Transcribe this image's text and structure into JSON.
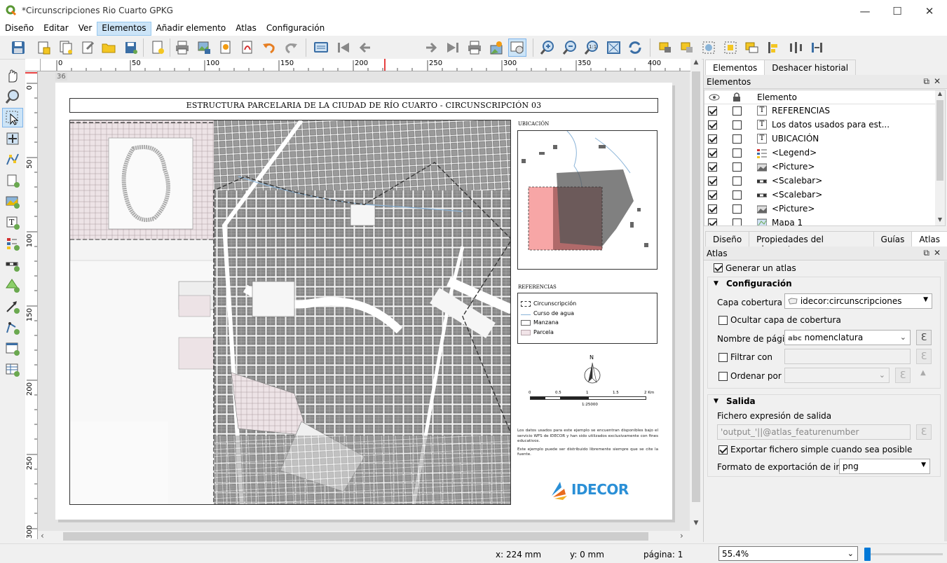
{
  "window": {
    "title": "*Circunscripciones Rio Cuarto GPKG",
    "controls": [
      "—",
      "☐",
      "✕"
    ]
  },
  "menu": [
    "Diseño",
    "Editar",
    "Ver",
    "Elementos",
    "Añadir elemento",
    "Atlas",
    "Configuración"
  ],
  "menu_active": "Elementos",
  "toolbar": {
    "page_number": "1",
    "icons": [
      "save-icon",
      "new-layout-icon",
      "duplicate-layout-icon",
      "layout-manager-icon",
      "open-template-icon",
      "save-template-icon",
      "new-page-icon",
      "print-icon",
      "export-image-icon",
      "export-svg-icon",
      "export-pdf-icon",
      "undo-icon",
      "redo-icon",
      "atlas-preview-icon",
      "first-feature-icon",
      "previous-feature-icon",
      "next-feature-icon",
      "last-feature-icon",
      "atlas-print-icon",
      "atlas-export-icon",
      "atlas-settings-icon",
      "zoom-in-icon",
      "zoom-out-icon",
      "zoom-actual-icon",
      "zoom-full-icon",
      "refresh-icon",
      "lock-icon",
      "unlock-icon",
      "group-icon",
      "ungroup-icon",
      "raise-icon",
      "align-icon",
      "distribute-icon",
      "resize-icon"
    ]
  },
  "left_tools": [
    "pan-icon",
    "zoom-tool-icon",
    "select-icon",
    "move-content-icon",
    "edit-nodes-icon",
    "add-map-icon",
    "add-picture-icon",
    "add-label-icon",
    "add-legend-icon",
    "add-scalebar-icon",
    "add-shape-icon",
    "add-arrow-icon",
    "add-node-item-icon",
    "add-html-icon",
    "add-table-icon"
  ],
  "rulers": {
    "h_labels": [
      "0",
      "50",
      "100",
      "150",
      "200",
      "250",
      "300",
      "350",
      "400"
    ],
    "v_labels": [
      "0",
      "50",
      "100",
      "150",
      "200",
      "250",
      "300"
    ],
    "marker": "36"
  },
  "layout": {
    "title": "ESTRUCTURA PARCELARIA DE LA CIUDAD DE RÍO CUARTO - CIRCUNSCRIPCIÓN 03",
    "ubicacion_label": "UBICACIÓN",
    "referencias_label": "REFERENCIAS",
    "legend": [
      "Circunscripción",
      "Curso de agua",
      "Manzana",
      "Parcela"
    ],
    "north": "N",
    "scale_ticks": [
      "0",
      "0.5",
      "1",
      "1.5",
      "2 Km"
    ],
    "scale_ratio": "1:25000",
    "disclaimer1": "Los datos usados para este ejemplo se encuentran disponibles bajo el servicio WFS de IDECOR y han sido utilizados exclusivamente con fines educativos.",
    "disclaimer2": "Este ejemplo puede ser distribuido libremente siempre que se cite la fuente.",
    "logo_text": "IDECOR",
    "colors": {
      "parcel": "#ddd0d4",
      "circ_highlight": "#f4a5a5",
      "logo": "#2a8fd6"
    }
  },
  "right_panel": {
    "top_tabs": [
      "Elementos",
      "Deshacer historial"
    ],
    "items_title": "Elementos",
    "items_header": "Elemento",
    "items": [
      {
        "visible": true,
        "locked": false,
        "icon": "label-item-icon",
        "name": "REFERENCIAS"
      },
      {
        "visible": true,
        "locked": false,
        "icon": "label-item-icon",
        "name": "Los datos usados para est..."
      },
      {
        "visible": true,
        "locked": false,
        "icon": "label-item-icon",
        "name": "UBICACIÓN"
      },
      {
        "visible": true,
        "locked": false,
        "icon": "legend-item-icon",
        "name": "<Legend>"
      },
      {
        "visible": true,
        "locked": false,
        "icon": "picture-item-icon",
        "name": "<Picture>"
      },
      {
        "visible": true,
        "locked": false,
        "icon": "scalebar-item-icon",
        "name": "<Scalebar>"
      },
      {
        "visible": true,
        "locked": false,
        "icon": "scalebar-item-icon",
        "name": "<Scalebar>"
      },
      {
        "visible": true,
        "locked": false,
        "icon": "picture-item-icon",
        "name": "<Picture>"
      },
      {
        "visible": true,
        "locked": false,
        "icon": "map-item-icon",
        "name": "Mapa 1"
      }
    ],
    "bottom_tabs": [
      "Diseño",
      "Propiedades del elemento",
      "Guías",
      "Atlas"
    ],
    "bottom_tab_selected": "Atlas",
    "atlas_title": "Atlas",
    "generate_atlas": {
      "label": "Generar un atlas",
      "checked": true
    },
    "config_label": "Configuración",
    "coverage_label": "Capa cobertura",
    "coverage_value": "idecor:circunscripciones",
    "hide_coverage": {
      "label": "Ocultar capa de cobertura",
      "checked": false
    },
    "page_name_label": "Nombre de página",
    "page_name_prefix": "abc",
    "page_name_value": "nomenclatura",
    "filter": {
      "label": "Filtrar con",
      "checked": false
    },
    "sort": {
      "label": "Ordenar por",
      "checked": false
    },
    "output_label": "Salida",
    "output_expr_label": "Fichero expresión de salida",
    "output_expr_value": "'output_'||@atlas_featurenumber",
    "single_file": {
      "label": "Exportar fichero simple cuando sea posible",
      "checked": true
    },
    "image_format_label": "Formato de exportación de imagen",
    "image_format_value": "png",
    "expr_symbol": "ℇ"
  },
  "status": {
    "x": "x: 224 mm",
    "y": "y: 0 mm",
    "page": "página: 1",
    "zoom": "55.4%"
  }
}
